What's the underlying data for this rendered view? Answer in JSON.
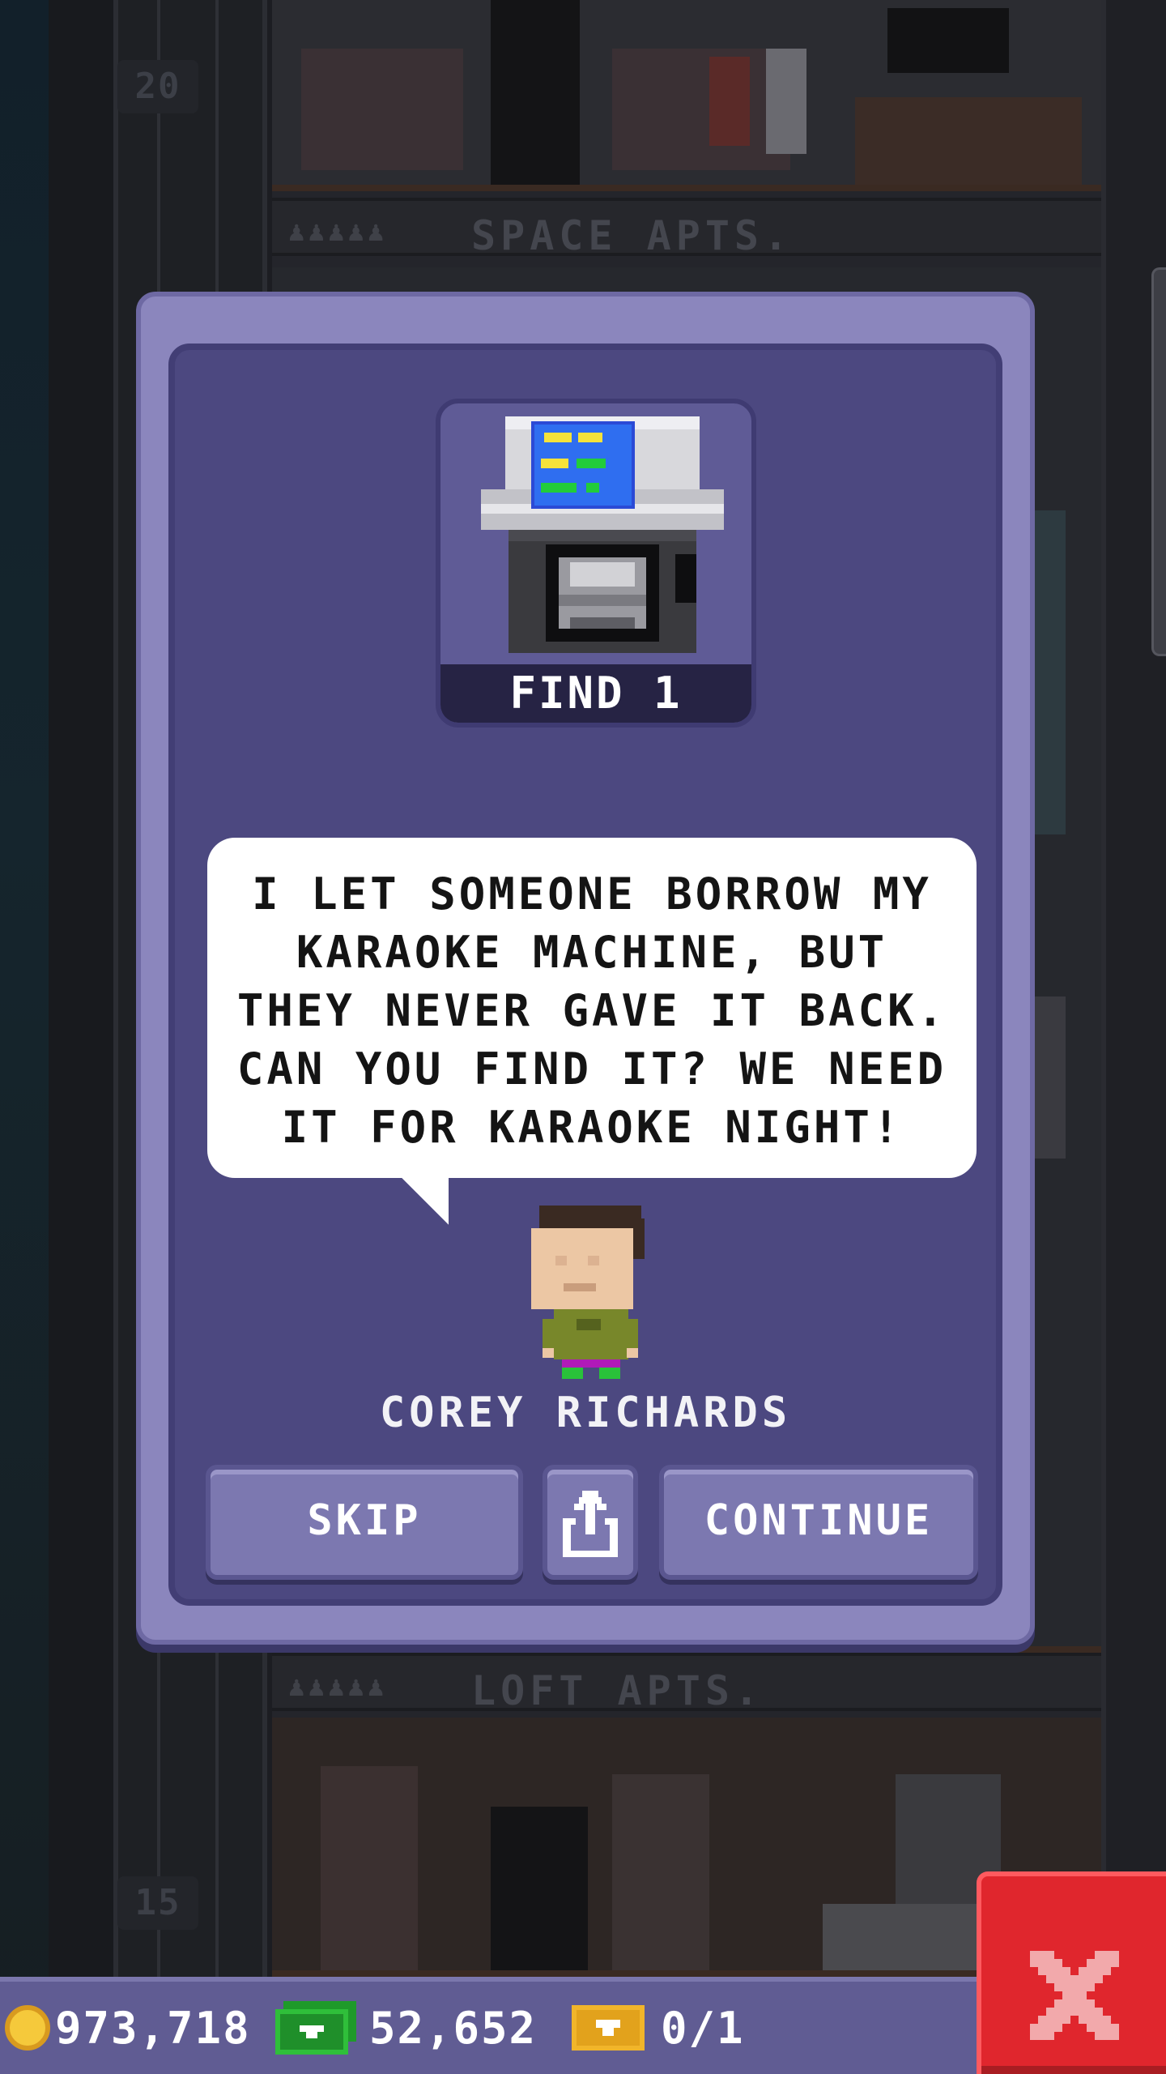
{
  "tower": {
    "floor_numbers": [
      "20",
      "15"
    ],
    "floor_labels": [
      {
        "dots": "♟♟♟♟♟",
        "name": "SPACE APTS."
      },
      {
        "dots": "♟♟♟♟♟",
        "name": "LOFT APTS."
      }
    ]
  },
  "mission_dialog": {
    "item_icon": "karaoke-machine-icon",
    "find_label": "FIND 1",
    "speech": "I LET SOMEONE BORROW MY KARAOKE MACHINE, BUT THEY NEVER GAVE IT BACK. CAN YOU FIND IT? WE NEED IT FOR KARAOKE NIGHT!",
    "character_name": "COREY RICHARDS",
    "buttons": {
      "skip": "SKIP",
      "share_icon": "share-icon",
      "continue": "CONTINUE"
    }
  },
  "hud": {
    "coins": "973,718",
    "coin_icon": "coin-icon",
    "bux": "52,652",
    "bux_icon": "bux-icon",
    "tickets": "0/1",
    "ticket_icon": "ticket-icon",
    "close_icon": "close-icon"
  },
  "colors": {
    "dialog_frame": "#8b86bd",
    "dialog_panel": "#4c4880",
    "button": "#7c78b0",
    "close_button": "#e0262d",
    "hud_bar": "#605c93"
  }
}
